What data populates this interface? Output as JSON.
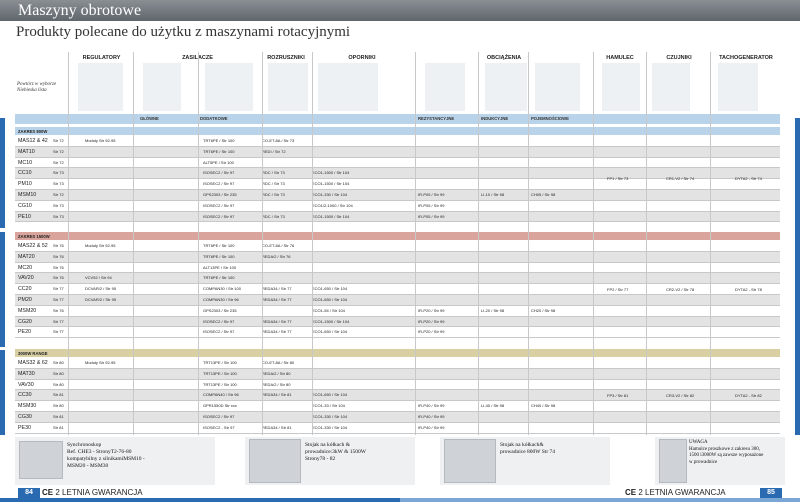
{
  "page": {
    "title": "Maszyny obrotowe",
    "subtitle": "Produkty polecane do użytku z maszynami rotacyjnymi"
  },
  "header": {
    "note": "Powtórz w wyborze Niebieska lista",
    "columns": [
      {
        "label": "REGULATORY"
      },
      {
        "label": "ZASILACZE"
      },
      {
        "label": "ROZRUSZNIKI"
      },
      {
        "label": "OPORNIKI"
      },
      {
        "label": "OBCIĄŻENIA"
      },
      {
        "label": "HAMULEC"
      },
      {
        "label": "CZUJNIKI"
      },
      {
        "label": "TACHOGENERATOR"
      }
    ],
    "subheads": [
      "GŁÓWNE",
      "DODATKOWE",
      "REZYSTANCYJNE",
      "INDUKCYJNE",
      "POJEMNOŚCIOWE"
    ]
  },
  "sections": [
    {
      "label": "ZAKRES 800W",
      "band_color": "#b9d4ea",
      "merged": {
        "hamulec": "FP1 / Str 73",
        "czujniki": "CR1-V2 / Str 74",
        "tacho": "DYTA2 - Str 74"
      },
      "rows": [
        {
          "model": "MAS12 & 42",
          "str": "Str 72",
          "reg": "Moduły Str 92-95",
          "gl": "TRT6PE / Str 100",
          "dod": "",
          "roz": "CO-ET-8A / Str 73",
          "opo": "",
          "rez": "",
          "ind": "",
          "poj": ""
        },
        {
          "model": "MAT10",
          "str": "Str 72",
          "reg": "",
          "gl": "TRT6PE / Str 100",
          "dod": "",
          "roz": "REDI / Str 72",
          "opo": "",
          "rez": "",
          "ind": "",
          "poj": ""
        },
        {
          "model": "MC10",
          "str": "Str 72",
          "reg": "",
          "gl": "ALT5PE / Str 100",
          "dod": "",
          "roz": "",
          "opo": "",
          "rez": "",
          "ind": "",
          "poj": ""
        },
        {
          "model": "CC10",
          "str": "Str 73",
          "reg": "",
          "gl": "",
          "dod": "ISOSEC2 / Str 97",
          "roz": "RDC / Str 73",
          "opo": "ECO1-1500 / Str 104",
          "rez": "",
          "ind": "",
          "poj": ""
        },
        {
          "model": "PM10",
          "str": "Str 73",
          "reg": "",
          "gl": "",
          "dod": "ISOSEC2 / Str 97",
          "roz": "RDC / Str 73",
          "opo": "ECO1-1500 / Str 104",
          "rez": "",
          "ind": "",
          "poj": ""
        },
        {
          "model": "MSM10",
          "str": "Str 72",
          "reg": "",
          "gl": "",
          "dod": "GPS2303 / Str 235",
          "roz": "RDC / Str 73",
          "opo": "ECO1-330 / Str 104",
          "rez": "IR-P05 / Str 99",
          "ind": "LI-10 / Str 98",
          "poj": "CH05 / Str 98"
        },
        {
          "model": "CG10",
          "str": "Str 73",
          "reg": "",
          "gl": "",
          "dod": "ISOSEC2 / Str 97",
          "roz": "",
          "opo": "ECO1/2-1000 / Str 104",
          "rez": "IR-P05 / Str 99",
          "ind": "",
          "poj": ""
        },
        {
          "model": "PE10",
          "str": "Str 73",
          "reg": "",
          "gl": "",
          "dod": "ISOSEC2 / Str 97",
          "roz": "RDC / Str 73",
          "opo": "ECO1-1500 / Str 104",
          "rez": "IR-P05 / Str 99",
          "ind": "",
          "poj": ""
        }
      ]
    },
    {
      "label": "ZAKRES 1500W",
      "band_color": "#d9a49c",
      "merged": {
        "hamulec": "FP2 / Str 77",
        "czujniki": "CR2-V2 / Str 78",
        "tacho": "DYTA2 - Str 78"
      },
      "rows": [
        {
          "model": "MAS22 & 52",
          "str": "Str 76",
          "reg": "Moduły Str 92-95",
          "gl": "TRT6PE / Str 100",
          "dod": "",
          "roz": "CO-ET-8A / Str 76",
          "opo": "",
          "rez": "",
          "ind": "",
          "poj": ""
        },
        {
          "model": "MAT20",
          "str": "Str 76",
          "reg": "",
          "gl": "TRT6PE / Str 100",
          "dod": "",
          "roz": "REDA/2 / Str 76",
          "opo": "",
          "rez": "",
          "ind": "",
          "poj": ""
        },
        {
          "model": "MC20",
          "str": "Str 76",
          "reg": "",
          "gl": "ALT13PE / Str 100",
          "dod": "",
          "roz": "",
          "opo": "",
          "rez": "",
          "ind": "",
          "poj": ""
        },
        {
          "model": "VAV20",
          "str": "Str 76",
          "reg": "VCV52 / Str 94",
          "gl": "TRT6PE / Str 100",
          "dod": "",
          "roz": "",
          "opo": "",
          "rez": "",
          "ind": "",
          "poj": ""
        },
        {
          "model": "CC20",
          "str": "Str 77",
          "reg": "DCVAR/2 / Str 95",
          "gl": "COMPAN30 / Str 100",
          "dod": "",
          "roz": "REDA34 / Str 77",
          "opo": "ECO1-650 / Str 104",
          "rez": "",
          "ind": "",
          "poj": ""
        },
        {
          "model": "PM20",
          "str": "Str 77",
          "reg": "DCVAR/2 / Str 95",
          "gl": "COMPAN30 / Str 96",
          "dod": "",
          "roz": "REDA34 / Str 77",
          "opo": "ECO1-650 / Str 104",
          "rez": "",
          "ind": "",
          "poj": ""
        },
        {
          "model": "MSM20",
          "str": "Str 76",
          "reg": "",
          "gl": "",
          "dod": "GPS2303 / Str 235",
          "roz": "",
          "opo": "ECO1-5II / Str 104",
          "rez": "IR-P20 / Str 99",
          "ind": "LI-20 / Str 98",
          "poj": "CH20 / Str 98"
        },
        {
          "model": "CG20",
          "str": "Str 77",
          "reg": "",
          "gl": "",
          "dod": "ISOSEC2 / Str 97",
          "roz": "REDA34 / Str 77",
          "opo": "ECO1-1500 / Str 104",
          "rez": "IR-P20 / Str 99",
          "ind": "",
          "poj": ""
        },
        {
          "model": "PE20",
          "str": "Str 77",
          "reg": "",
          "gl": "",
          "dod": "ISOSEC2 / Str 97",
          "roz": "REDA34 / Str 77",
          "opo": "ECO1-650 / Str 104",
          "rez": "IR-P20 / Str 99",
          "ind": "",
          "poj": ""
        }
      ]
    },
    {
      "label": "3000W RANGE",
      "band_color": "#d8d0a2",
      "merged": {
        "hamulec": "FP3 / Str 81",
        "czujniki": "CR3-V2 / Str 82",
        "tacho": "DYTA2 - Str 82"
      },
      "rows": [
        {
          "model": "MAS32 & 62",
          "str": "Str 80",
          "reg": "Moduły Str 92-95",
          "gl": "TRT13PE / Str 100",
          "dod": "",
          "roz": "CO-ET-8A / Str 80",
          "opo": "",
          "rez": "",
          "ind": "",
          "poj": ""
        },
        {
          "model": "MAT30",
          "str": "Str 80",
          "reg": "",
          "gl": "TRT13PE / Str 100",
          "dod": "",
          "roz": "REDA/2 / Str 80",
          "opo": "",
          "rez": "",
          "ind": "",
          "poj": ""
        },
        {
          "model": "VAV30",
          "str": "Str 80",
          "reg": "",
          "gl": "TRT13PE / Str 100",
          "dod": "",
          "roz": "REDA/2 / Str 80",
          "opo": "",
          "rez": "",
          "ind": "",
          "poj": ""
        },
        {
          "model": "CC30",
          "str": "Str 81",
          "reg": "",
          "gl": "COMPAN40 / Str 96",
          "dod": "",
          "roz": "REDA34 / Str 81",
          "opo": "ECO1-650 / Str 104",
          "rez": "",
          "ind": "",
          "poj": ""
        },
        {
          "model": "MSM30",
          "str": "Str 80",
          "reg": "",
          "gl": "",
          "dod": "GPR1550D Str xxx",
          "roz": "",
          "opo": "ECO1-33 / Str 104",
          "rez": "IR-P40 / Str 99",
          "ind": "LI-40 / Str 98",
          "poj": "CH40 / Str 98"
        },
        {
          "model": "CG30",
          "str": "Str 81",
          "reg": "",
          "gl": "",
          "dod": "ISOSEC2 / Str 97",
          "roz": "",
          "opo": "ECO1-330 / Str 104",
          "rez": "IR-P40 / Str 99",
          "ind": "",
          "poj": ""
        },
        {
          "model": "PE30",
          "str": "Str 81",
          "reg": "",
          "gl": "",
          "dod": "ISOSEC2 - Str 97",
          "roz": "REDA34 / Str 81",
          "opo": "ECO1-330 / Str 104",
          "rez": "IR-P40 / Str 99",
          "ind": "",
          "poj": ""
        }
      ]
    }
  ],
  "footer": {
    "boxes": [
      {
        "text": "Synchronoskop\nRef. CHE3 - StronyT2-76-80\nkompatybilny z silnikamiMSM10 -\nMSM20 - MSM30"
      },
      {
        "text": "Stojak na kółkach &\nprowadnice:3kW & 1500W\nStrony78 - 82"
      },
      {
        "text": "Stojak na kółkach&\nprowadnice 800W Str 74"
      },
      {
        "text": "UWAGA\nHamulce proszkowe z zakresu 300,\n1500 i3000W są zawsze wyposażone\nw prowadnice"
      }
    ],
    "left_page": "84",
    "right_page": "85",
    "guarantee": "2 LETNIA GWARANCJA",
    "ce_mark": "CE"
  },
  "colors": {
    "accent": "#2a6ab0",
    "titlebar": "#6b7177"
  }
}
